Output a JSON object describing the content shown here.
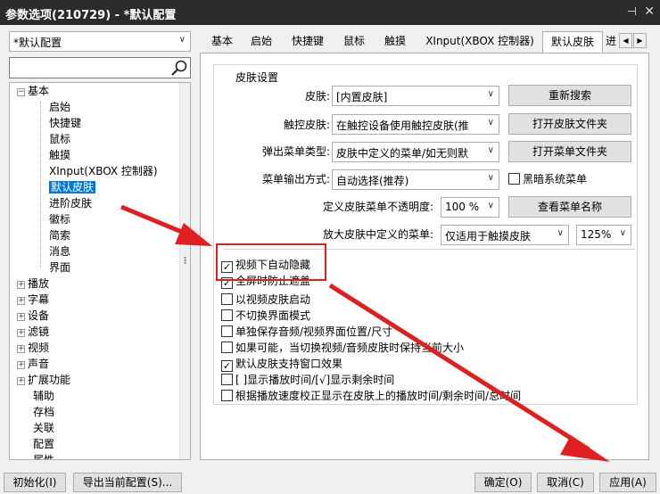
{
  "window": {
    "title": "参数选项(210729) - *默认配置",
    "pin_icon": "pin-icon",
    "close_icon": "close-icon"
  },
  "preset": {
    "value": "*默认配置"
  },
  "search": {
    "value": "",
    "icon": "search-icon"
  },
  "tree": {
    "root": "基本",
    "children": [
      "启始",
      "快捷键",
      "鼠标",
      "触摸",
      "XInput(XBOX 控制器)",
      "默认皮肤",
      "进阶皮肤",
      "徽标",
      "简索",
      "消息",
      "界面"
    ],
    "selected": "默认皮肤",
    "collapsed": [
      "播放",
      "字幕",
      "设备",
      "滤镜",
      "视频",
      "声音",
      "扩展功能"
    ],
    "leaves": [
      "辅助",
      "存档",
      "关联",
      "配置",
      "属性"
    ]
  },
  "tabs": [
    "基本",
    "启始",
    "快捷键",
    "鼠标",
    "触摸",
    "XInput(XBOX 控制器)",
    "默认皮肤",
    "进"
  ],
  "active_tab": "默认皮肤",
  "skin": {
    "group_title": "皮肤设置",
    "skin_label": "皮肤:",
    "skin_value": "[内置皮肤]",
    "rescan_button": "重新搜索",
    "touch_label": "触控皮肤:",
    "touch_value": "在触控设备使用触控皮肤(推",
    "open_skin_folder": "打开皮肤文件夹",
    "popup_label": "弹出菜单类型:",
    "popup_value": "皮肤中定义的菜单/如无则默",
    "open_menu_folder": "打开菜单文件夹",
    "menu_output_label": "菜单输出方式:",
    "menu_output_value": "自动选择(推荐)",
    "dark_menu": "黑暗系统菜单",
    "opacity_label": "定义皮肤菜单不透明度:",
    "opacity_value": "100 %",
    "view_menu_name": "查看菜单名称",
    "zoom_label": "放大皮肤中定义的菜单:",
    "zoom_mode_value": "仅适用于触摸皮肤",
    "zoom_value": "125%"
  },
  "options": [
    {
      "label": "视频下自动隐藏",
      "checked": true
    },
    {
      "label": "全屏时防止遮盖",
      "checked": true
    },
    {
      "label": "以视频皮肤启动",
      "checked": false
    },
    {
      "label": "不切换界面模式",
      "checked": false
    },
    {
      "label": "单独保存音频/视频界面位置/尺寸",
      "checked": false
    },
    {
      "label": "如果可能，当切换视频/音频皮肤时保持当前大小",
      "checked": false
    },
    {
      "label": "默认皮肤支持窗口效果",
      "checked": true
    },
    {
      "label": "[ ]显示播放时间/[√]显示剩余时间",
      "checked": false
    },
    {
      "label": "根据播放速度校正显示在皮肤上的播放时间/剩余时间/总时间",
      "checked": false
    }
  ],
  "footer": {
    "init": "初始化(I)",
    "export": "导出当前配置(S)...",
    "ok": "确定(O)",
    "cancel": "取消(C)",
    "apply": "应用(A)"
  },
  "colors": {
    "highlight": "#0078d7",
    "annotation": "#e02020"
  }
}
